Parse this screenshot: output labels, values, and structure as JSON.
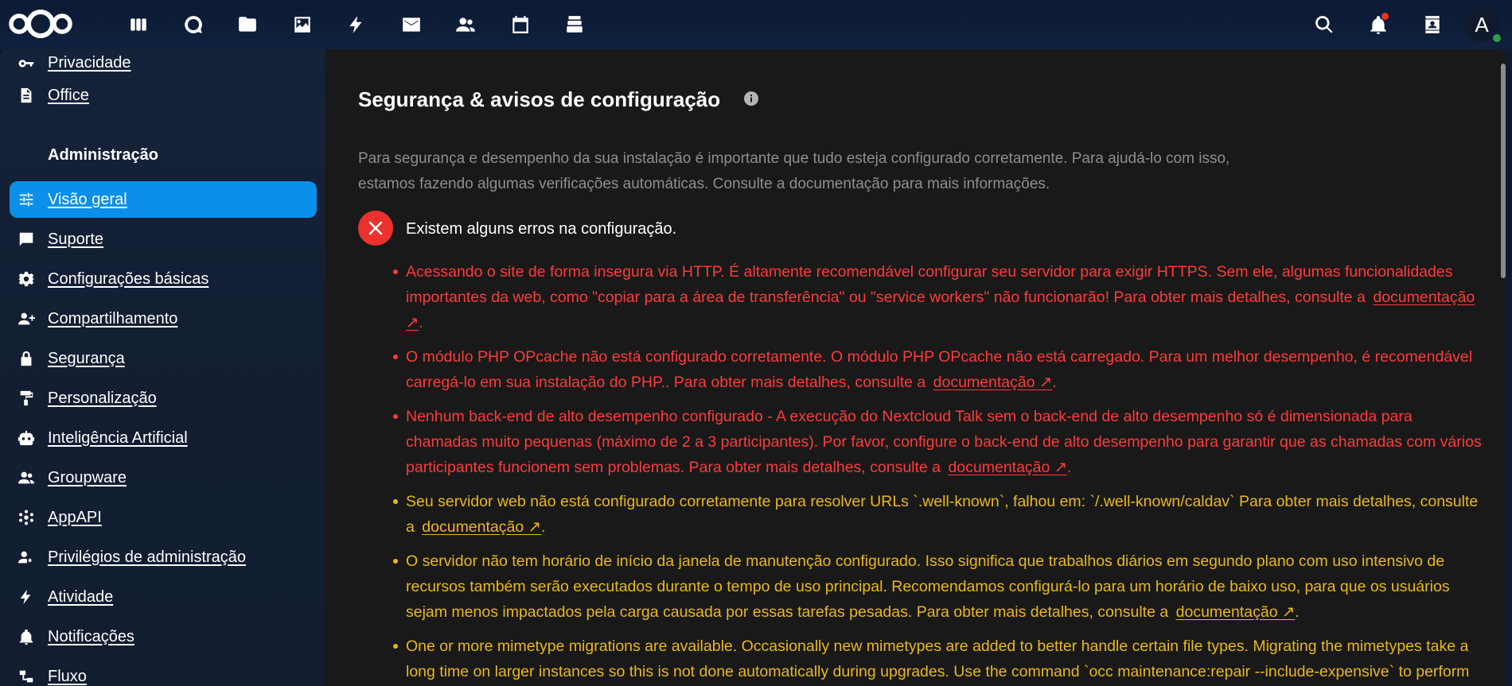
{
  "colors": {
    "accent": "#0b8fe8",
    "error": "#ff3a3a",
    "warning": "#e9b81a",
    "header_bg": "#0c1a33",
    "main_bg": "#191919"
  },
  "header": {
    "logo_icon": "nextcloud-logo",
    "apps": [
      {
        "name": "dashboard",
        "icon": "dashboard-icon"
      },
      {
        "name": "talk",
        "icon": "talk-icon"
      },
      {
        "name": "files",
        "icon": "folder-icon"
      },
      {
        "name": "photos",
        "icon": "image-icon"
      },
      {
        "name": "activity",
        "icon": "lightning-icon"
      },
      {
        "name": "mail",
        "icon": "mail-icon"
      },
      {
        "name": "contacts",
        "icon": "contacts-icon"
      },
      {
        "name": "calendar",
        "icon": "calendar-icon"
      },
      {
        "name": "deck",
        "icon": "deck-icon"
      }
    ],
    "avatar_initial": "A"
  },
  "sidebar": {
    "items_top": [
      {
        "label": "Privacidade",
        "icon": "key-icon"
      },
      {
        "label": "Office",
        "icon": "document-icon"
      }
    ],
    "admin_heading": "Administração",
    "items": [
      {
        "label": "Visão geral",
        "icon": "tune-icon",
        "active": true
      },
      {
        "label": "Suporte",
        "icon": "chat-icon"
      },
      {
        "label": "Configurações básicas",
        "icon": "gear-icon"
      },
      {
        "label": "Compartilhamento",
        "icon": "share-icon"
      },
      {
        "label": "Segurança",
        "icon": "lock-icon"
      },
      {
        "label": "Personalização",
        "icon": "paint-roller-icon"
      },
      {
        "label": "Inteligência Artificial",
        "icon": "robot-icon"
      },
      {
        "label": "Groupware",
        "icon": "group-icon"
      },
      {
        "label": "AppAPI",
        "icon": "cog-cluster-icon"
      },
      {
        "label": "Privilégios de administração",
        "icon": "admin-user-icon"
      },
      {
        "label": "Atividade",
        "icon": "lightning-icon"
      },
      {
        "label": "Notificações",
        "icon": "bell-icon"
      },
      {
        "label": "Fluxo",
        "icon": "flow-icon"
      }
    ]
  },
  "main": {
    "title": "Segurança & avisos de configuração",
    "intro_line1": "Para segurança e desempenho da sua instalação é importante que tudo esteja configurado corretamente. Para ajudá-lo com isso,",
    "intro_line2": "estamos fazendo algumas verificações automáticas. Consulte a documentação para mais informações.",
    "error_heading": "Existem alguns erros na configuração.",
    "link_label": "documentação ↗",
    "issues": [
      {
        "level": "error",
        "text": "Acessando o site de forma insegura via HTTP. É altamente recomendável configurar seu servidor para exigir HTTPS. Sem ele, algumas funcionalidades importantes da web, como \"copiar para a área de transferência\" ou \"service workers\" não funcionarão! Para obter mais detalhes, consulte a"
      },
      {
        "level": "error",
        "text": "O módulo PHP OPcache não está configurado corretamente. O módulo PHP OPcache não está carregado. Para um melhor desempenho, é recomendável carregá-lo em sua instalação do PHP.. Para obter mais detalhes, consulte a"
      },
      {
        "level": "error",
        "text": "Nenhum back-end de alto desempenho configurado - A execução do Nextcloud Talk sem o back-end de alto desempenho só é dimensionada para chamadas muito pequenas (máximo de 2 a 3 participantes). Por favor, configure o back-end de alto desempenho para garantir que as chamadas com vários participantes funcionem sem problemas. Para obter mais detalhes, consulte a"
      },
      {
        "level": "warning",
        "text": "Seu servidor web não está configurado corretamente para resolver URLs `.well-known`, falhou em: `/.well-known/caldav` Para obter mais detalhes, consulte a"
      },
      {
        "level": "warning",
        "text": "O servidor não tem horário de início da janela de manutenção configurado. Isso significa que trabalhos diários em segundo plano com uso intensivo de recursos também serão executados durante o tempo de uso principal. Recomendamos configurá-lo para um horário de baixo uso, para que os usuários sejam menos impactados pela carga causada por essas tarefas pesadas. Para obter mais detalhes, consulte a"
      },
      {
        "level": "warning",
        "text": "One or more mimetype migrations are available. Occasionally new mimetypes are added to better handle certain file types. Migrating the mimetypes take a long time on larger instances so this is not done automatically during upgrades. Use the command `occ maintenance:repair --include-expensive` to perform the migrations."
      }
    ]
  }
}
